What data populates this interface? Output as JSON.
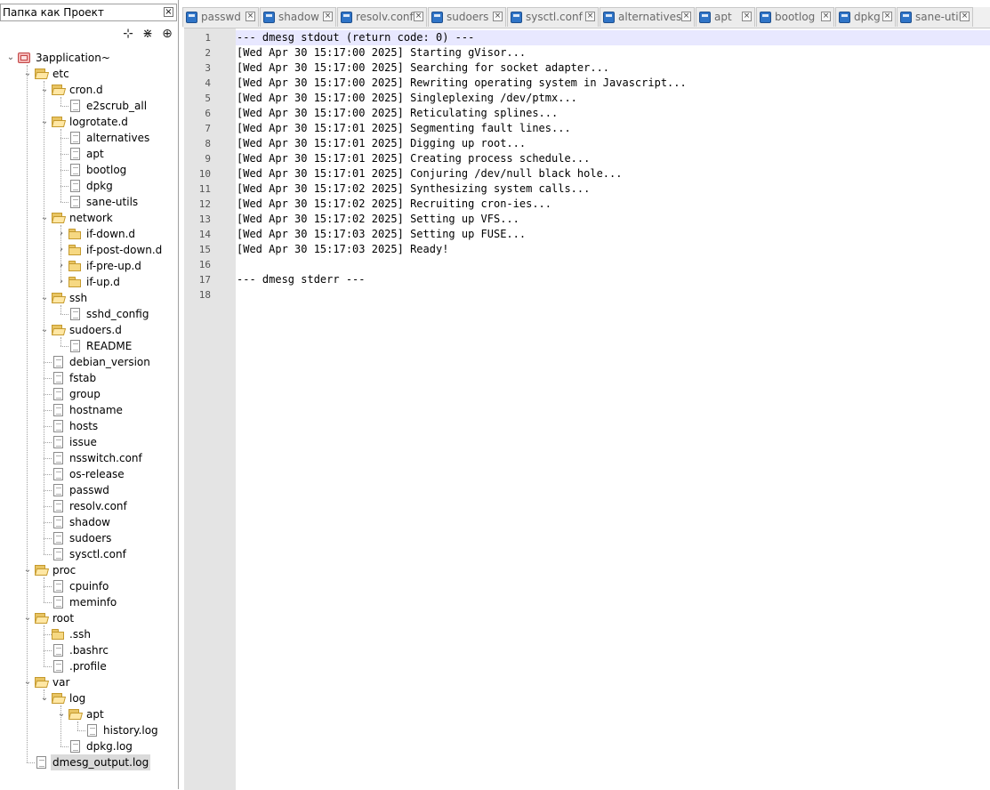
{
  "panel": {
    "title": "Папка как Проект",
    "close_glyph": "×",
    "tools": [
      {
        "name": "collapse-all-icon",
        "glyph": "⊹"
      },
      {
        "name": "expand-all-icon",
        "glyph": "⋇"
      },
      {
        "name": "locate-icon",
        "glyph": "⊕"
      }
    ]
  },
  "tree": [
    {
      "label": "3application~",
      "depth": 0,
      "icon": "project",
      "expanded": true
    },
    {
      "label": "etc",
      "depth": 1,
      "icon": "open-folder",
      "expanded": true
    },
    {
      "label": "cron.d",
      "depth": 2,
      "icon": "open-folder",
      "expanded": true
    },
    {
      "label": "e2scrub_all",
      "depth": 3,
      "icon": "file"
    },
    {
      "label": "logrotate.d",
      "depth": 2,
      "icon": "open-folder",
      "expanded": true
    },
    {
      "label": "alternatives",
      "depth": 3,
      "icon": "file"
    },
    {
      "label": "apt",
      "depth": 3,
      "icon": "file"
    },
    {
      "label": "bootlog",
      "depth": 3,
      "icon": "file"
    },
    {
      "label": "dpkg",
      "depth": 3,
      "icon": "file"
    },
    {
      "label": "sane-utils",
      "depth": 3,
      "icon": "file"
    },
    {
      "label": "network",
      "depth": 2,
      "icon": "open-folder",
      "expanded": true
    },
    {
      "label": "if-down.d",
      "depth": 3,
      "icon": "folder",
      "expanded": false
    },
    {
      "label": "if-post-down.d",
      "depth": 3,
      "icon": "folder",
      "expanded": false
    },
    {
      "label": "if-pre-up.d",
      "depth": 3,
      "icon": "folder",
      "expanded": false
    },
    {
      "label": "if-up.d",
      "depth": 3,
      "icon": "folder",
      "expanded": false
    },
    {
      "label": "ssh",
      "depth": 2,
      "icon": "open-folder",
      "expanded": true
    },
    {
      "label": "sshd_config",
      "depth": 3,
      "icon": "file"
    },
    {
      "label": "sudoers.d",
      "depth": 2,
      "icon": "open-folder",
      "expanded": true
    },
    {
      "label": "README",
      "depth": 3,
      "icon": "file"
    },
    {
      "label": "debian_version",
      "depth": 2,
      "icon": "file"
    },
    {
      "label": "fstab",
      "depth": 2,
      "icon": "file"
    },
    {
      "label": "group",
      "depth": 2,
      "icon": "file"
    },
    {
      "label": "hostname",
      "depth": 2,
      "icon": "file"
    },
    {
      "label": "hosts",
      "depth": 2,
      "icon": "file"
    },
    {
      "label": "issue",
      "depth": 2,
      "icon": "file"
    },
    {
      "label": "nsswitch.conf",
      "depth": 2,
      "icon": "file"
    },
    {
      "label": "os-release",
      "depth": 2,
      "icon": "file"
    },
    {
      "label": "passwd",
      "depth": 2,
      "icon": "file"
    },
    {
      "label": "resolv.conf",
      "depth": 2,
      "icon": "file"
    },
    {
      "label": "shadow",
      "depth": 2,
      "icon": "file"
    },
    {
      "label": "sudoers",
      "depth": 2,
      "icon": "file"
    },
    {
      "label": "sysctl.conf",
      "depth": 2,
      "icon": "file"
    },
    {
      "label": "proc",
      "depth": 1,
      "icon": "open-folder",
      "expanded": true
    },
    {
      "label": "cpuinfo",
      "depth": 2,
      "icon": "file"
    },
    {
      "label": "meminfo",
      "depth": 2,
      "icon": "file"
    },
    {
      "label": "root",
      "depth": 1,
      "icon": "open-folder",
      "expanded": true
    },
    {
      "label": ".ssh",
      "depth": 2,
      "icon": "folder"
    },
    {
      "label": ".bashrc",
      "depth": 2,
      "icon": "file"
    },
    {
      "label": ".profile",
      "depth": 2,
      "icon": "file"
    },
    {
      "label": "var",
      "depth": 1,
      "icon": "open-folder",
      "expanded": true
    },
    {
      "label": "log",
      "depth": 2,
      "icon": "open-folder",
      "expanded": true
    },
    {
      "label": "apt",
      "depth": 3,
      "icon": "open-folder",
      "expanded": true
    },
    {
      "label": "history.log",
      "depth": 4,
      "icon": "file"
    },
    {
      "label": "dpkg.log",
      "depth": 3,
      "icon": "file"
    },
    {
      "label": "dmesg_output.log",
      "depth": 1,
      "icon": "file",
      "selected": true
    }
  ],
  "tabs": [
    {
      "label": "passwd"
    },
    {
      "label": "shadow"
    },
    {
      "label": "resolv.conf"
    },
    {
      "label": "sudoers"
    },
    {
      "label": "sysctl.conf"
    },
    {
      "label": "alternatives"
    },
    {
      "label": "apt"
    },
    {
      "label": "bootlog"
    },
    {
      "label": "dpkg"
    },
    {
      "label": "sane-utils"
    }
  ],
  "tab_close_glyph": "×",
  "editor": {
    "lines": [
      "--- dmesg stdout (return code: 0) ---",
      "[Wed Apr 30 15:17:00 2025] Starting gVisor...",
      "[Wed Apr 30 15:17:00 2025] Searching for socket adapter...",
      "[Wed Apr 30 15:17:00 2025] Rewriting operating system in Javascript...",
      "[Wed Apr 30 15:17:00 2025] Singleplexing /dev/ptmx...",
      "[Wed Apr 30 15:17:00 2025] Reticulating splines...",
      "[Wed Apr 30 15:17:01 2025] Segmenting fault lines...",
      "[Wed Apr 30 15:17:01 2025] Digging up root...",
      "[Wed Apr 30 15:17:01 2025] Creating process schedule...",
      "[Wed Apr 30 15:17:01 2025] Conjuring /dev/null black hole...",
      "[Wed Apr 30 15:17:02 2025] Synthesizing system calls...",
      "[Wed Apr 30 15:17:02 2025] Recruiting cron-ies...",
      "[Wed Apr 30 15:17:02 2025] Setting up VFS...",
      "[Wed Apr 30 15:17:03 2025] Setting up FUSE...",
      "[Wed Apr 30 15:17:03 2025] Ready!",
      "",
      "--- dmesg stderr ---",
      ""
    ]
  },
  "colors": {
    "current_line": "#e8e8ff",
    "gutter": "#e4e4e4",
    "tab_icon": "#2f74c7"
  }
}
